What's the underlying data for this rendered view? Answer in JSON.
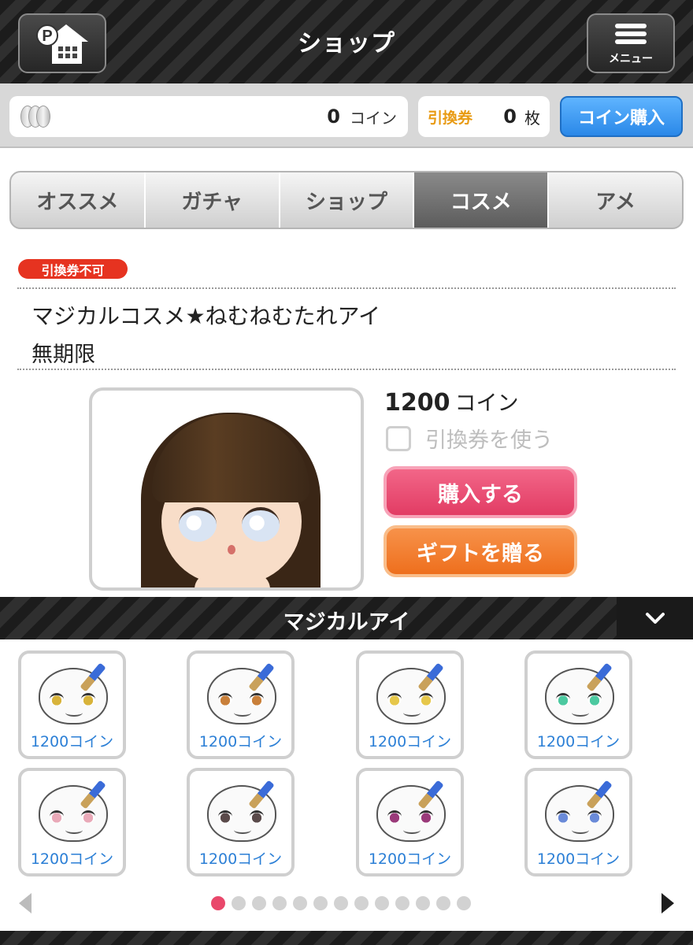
{
  "header": {
    "title": "ショップ",
    "menu_label": "メニュー",
    "home_icon": "p-home-icon",
    "menu_icon": "hamburger-icon"
  },
  "coins": {
    "amount": "0",
    "unit": "コイン",
    "icon": "coin-stack-icon"
  },
  "tickets": {
    "label": "引換券",
    "count": "0",
    "unit": "枚"
  },
  "buy_coin_label": "コイン購入",
  "tabs": [
    {
      "label": "オススメ",
      "active": false
    },
    {
      "label": "ガチャ",
      "active": false
    },
    {
      "label": "ショップ",
      "active": false
    },
    {
      "label": "コスメ",
      "active": true
    },
    {
      "label": "アメ",
      "active": false
    }
  ],
  "item": {
    "badge": "引換券不可",
    "name": "マジカルコスメ★ねむねむたれアイ",
    "period": "無期限",
    "price": "1200",
    "price_unit": "コイン",
    "use_ticket_label": "引換券を使う",
    "use_ticket_checked": false,
    "buy_label": "購入する",
    "gift_label": "ギフトを贈る"
  },
  "category": {
    "title": "マジカルアイ",
    "toggle_icon": "chevron-down-icon"
  },
  "grid_items": [
    {
      "price": "1200コイン",
      "eye_color": "#d8b33a"
    },
    {
      "price": "1200コイン",
      "eye_color": "#c9803a"
    },
    {
      "price": "1200コイン",
      "eye_color": "#e6c74a"
    },
    {
      "price": "1200コイン",
      "eye_color": "#4cc9a0"
    },
    {
      "price": "1200コイン",
      "eye_color": "#e9a9b8"
    },
    {
      "price": "1200コイン",
      "eye_color": "#5a4a4a"
    },
    {
      "price": "1200コイン",
      "eye_color": "#9a3a7a"
    },
    {
      "price": "1200コイン",
      "eye_color": "#6a8ad8"
    }
  ],
  "pager": {
    "pages": 13,
    "current": 1
  },
  "colors": {
    "accent_pink": "#e9486b",
    "accent_blue": "#2a88e8",
    "accent_orange": "#ee6f1d",
    "ticket_orange": "#e89a12",
    "badge_red": "#e63320"
  }
}
